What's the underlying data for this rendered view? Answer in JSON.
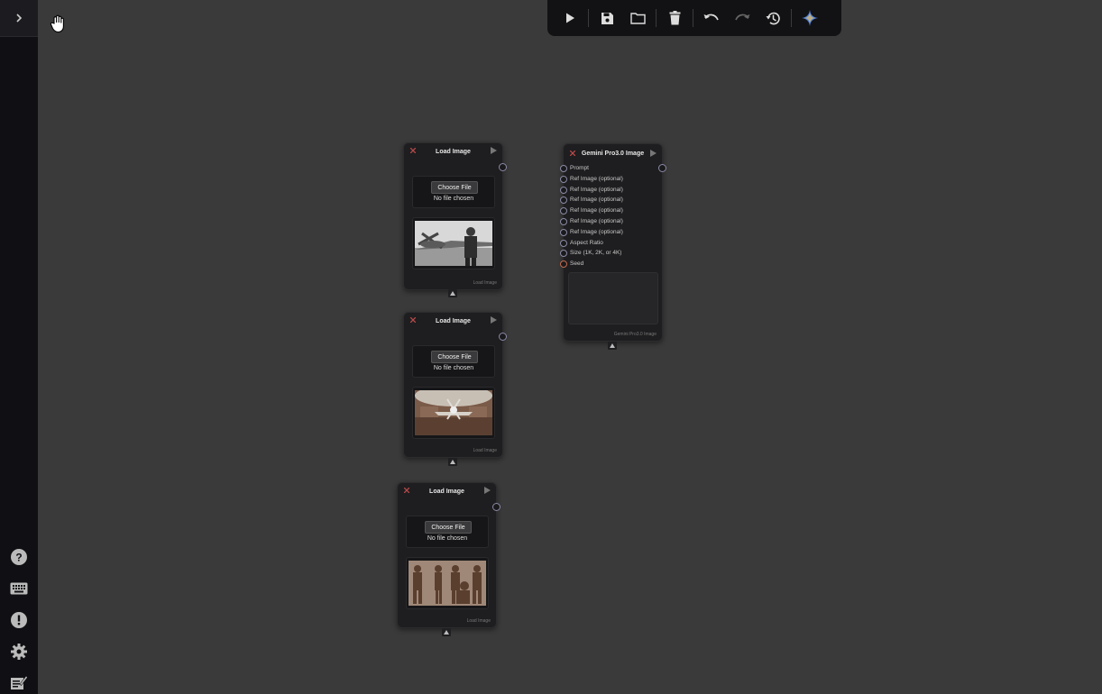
{
  "toolbar": {
    "icons": [
      "play-icon",
      "save-icon",
      "folder-icon",
      "trash-icon",
      "undo-icon",
      "redo-icon",
      "history-icon",
      "gemini-star-icon"
    ]
  },
  "sidebar": {
    "icons": [
      "help-icon",
      "keyboard-icon",
      "alert-icon",
      "gear-icon",
      "notes-icon"
    ]
  },
  "load_nodes": [
    {
      "title": "Load Image",
      "button": "Choose File",
      "status": "No file chosen",
      "footer": "Load Image",
      "preview": "biplane-pilot-bw"
    },
    {
      "title": "Load Image",
      "button": "Choose File",
      "status": "No file chosen",
      "footer": "Load Image",
      "preview": "hangar-plane"
    },
    {
      "title": "Load Image",
      "button": "Choose File",
      "status": "No file chosen",
      "footer": "Load Image",
      "preview": "character-turnaround"
    }
  ],
  "gemini_node": {
    "title": "Gemini Pro3.0 Image",
    "inputs": [
      "Prompt",
      "Ref Image (optional)",
      "Ref Image (optional)",
      "Ref Image (optional)",
      "Ref Image (optional)",
      "Ref Image (optional)",
      "Ref Image (optional)",
      "Aspect Ratio",
      "Size (1K, 2K, or 4K)",
      "Seed"
    ],
    "footer": "Gemini Pro3.0 Image"
  },
  "colors": {
    "canvas": "#3a3a3a",
    "sidebar": "#101014",
    "node": "#1e1e20",
    "port": "#8a8aa6",
    "seed_port": "#c46a4e"
  }
}
